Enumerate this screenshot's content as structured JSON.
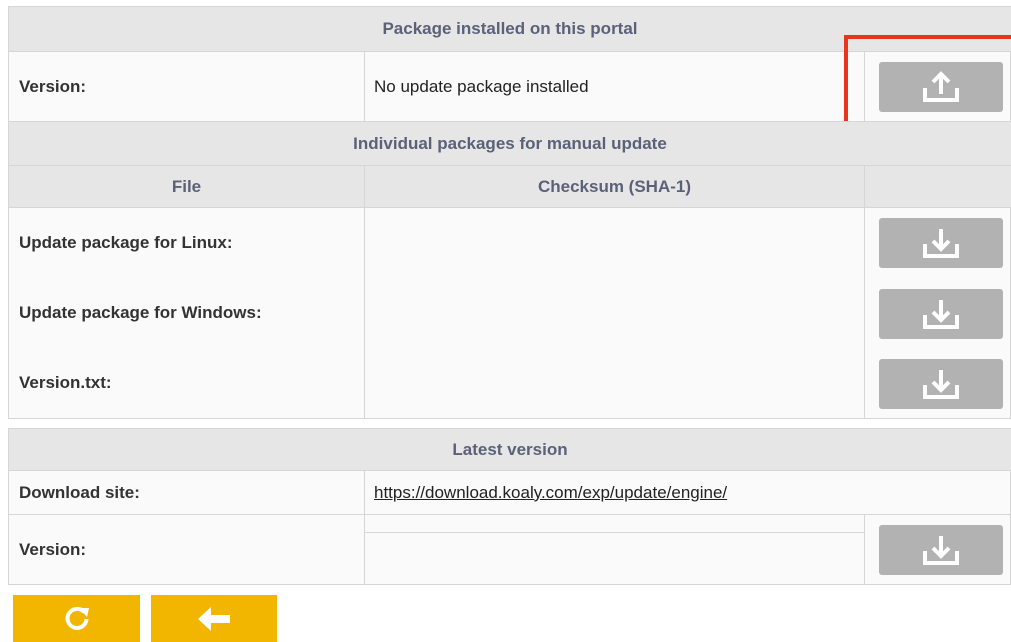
{
  "installed": {
    "header": "Package installed on this portal",
    "version_label": "Version:",
    "version_value": "No update package installed",
    "upload_icon": "upload-icon"
  },
  "individual": {
    "header": "Individual packages for manual update",
    "columns": [
      "File",
      "Checksum (SHA-1)",
      ""
    ],
    "rows": [
      {
        "label": "Update package for Linux:",
        "checksum": "",
        "icon": "download-icon"
      },
      {
        "label": "Update package for Windows:",
        "checksum": "",
        "icon": "download-icon"
      },
      {
        "label": "Version.txt:",
        "checksum": "",
        "icon": "download-icon"
      }
    ]
  },
  "latest": {
    "header": "Latest version",
    "download_site_label": "Download site:",
    "download_site_url": "https://download.koaly.com/exp/update/engine/",
    "version_label": "Version:",
    "version_value": "",
    "icon": "download-icon"
  },
  "footer": {
    "refresh_icon": "refresh-icon",
    "back_icon": "arrow-left-icon"
  },
  "colors": {
    "header_bg": "#e6e6e6",
    "header_text": "#5b6178",
    "button_gray": "#b2b2b2",
    "button_yellow": "#f2b500",
    "highlight_red": "#e8351e"
  }
}
